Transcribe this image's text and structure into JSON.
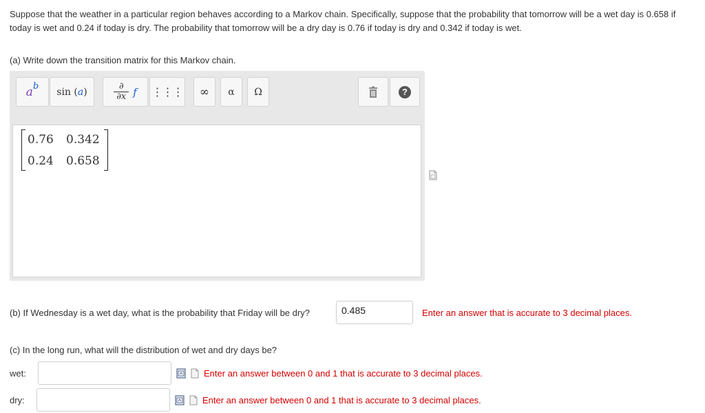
{
  "problem": {
    "text": "Suppose that the weather in a particular region behaves according to a Markov chain. Specifically, suppose that the probability that tomorrow will be a wet day is 0.658 if today is wet and 0.24 if today is dry. The probability that tomorrow will be a dry day is 0.76 if today is dry and 0.342 if today is wet."
  },
  "part_a": {
    "question": "(a) Write down the transition matrix for this Markov chain.",
    "toolbar": {
      "superscript": {
        "base": "a",
        "exp": "b"
      },
      "sin_label": "sin",
      "sin_arg": "a",
      "partial": {
        "top": "∂",
        "bottom": "∂x",
        "f": "f"
      },
      "matrix_glyph": "⋮⋮⋮",
      "infinity": "∞",
      "alpha": "α",
      "omega": "Ω",
      "help": "?"
    },
    "matrix": [
      [
        "0.76",
        "0.342"
      ],
      [
        "0.24",
        "0.658"
      ]
    ]
  },
  "part_b": {
    "question": "(b) If Wednesday is a wet day, what is the probability that Friday will be dry?",
    "answer": "0.485",
    "hint": "Enter an answer that is accurate to 3 decimal places."
  },
  "part_c": {
    "question": "(c) In the long run, what will the distribution of wet and dry days be?",
    "wet_label": "wet:",
    "wet_value": "",
    "wet_hint": "Enter an answer between 0 and 1 that is accurate to 3 decimal places.",
    "dry_label": "dry:",
    "dry_value": "",
    "dry_hint": "Enter an answer between 0 and 1 that is accurate to 3 decimal places."
  },
  "colors": {
    "hint_red": "#d40000",
    "superscript_blue": "#1a5bd6",
    "base_purple": "#7a3fb0"
  },
  "icons": [
    "trash-icon",
    "help-icon",
    "preview-icon",
    "pdf-icon"
  ]
}
